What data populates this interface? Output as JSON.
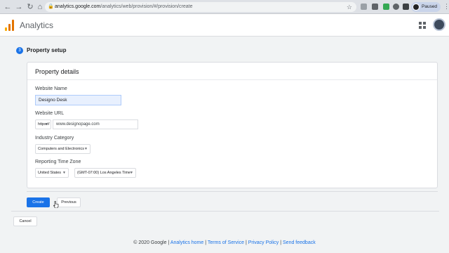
{
  "browser": {
    "nav": {
      "back": "←",
      "forward": "→",
      "reload": "↻",
      "home": "⌂"
    },
    "url_host": "analytics.google.com",
    "url_path": "/analytics/web/provision/#/provision/create",
    "profile_label": "Paused",
    "menu_glyph": "⋮"
  },
  "app": {
    "title": "Analytics",
    "logo_colors": [
      "#f9ab00",
      "#e37400",
      "#e37400"
    ]
  },
  "step": {
    "number": "3",
    "title": "Property setup"
  },
  "card": {
    "title": "Property details",
    "website_name_label": "Website Name",
    "website_name_value": "Designo Desk",
    "website_url_label": "Website URL",
    "protocol_value": "https://",
    "url_value": "www.designopage.com",
    "industry_label": "Industry Category",
    "industry_value": "Computers and Electronics",
    "timezone_label": "Reporting Time Zone",
    "country_value": "United States",
    "timezone_value": "(GMT-07:00) Los Angeles Time"
  },
  "buttons": {
    "create": "Create",
    "previous": "Previous",
    "cancel": "Cancel"
  },
  "footer": {
    "copyright": "© 2020 Google",
    "links": [
      "Analytics home",
      "Terms of Service",
      "Privacy Policy",
      "Send feedback"
    ],
    "separator": " | "
  },
  "colors": {
    "accent": "#1a73e8",
    "autofill_bg": "#e8f0fe"
  }
}
